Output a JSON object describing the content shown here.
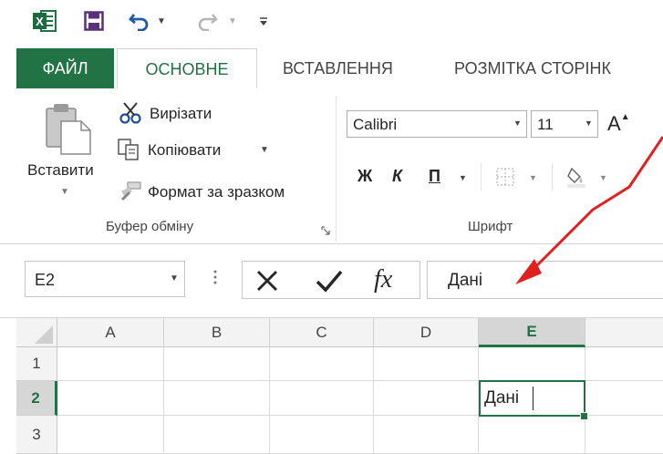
{
  "tabs": {
    "file": "ФАЙЛ",
    "home": "ОСНОВНЕ",
    "insert": "ВСТАВЛЕННЯ",
    "page_layout": "РОЗМІТКА СТОРІНК"
  },
  "clipboard": {
    "paste": "Вставити",
    "cut": "Вирізати",
    "copy": "Копіювати",
    "format_painter": "Формат за зразком",
    "group_label": "Буфер обміну"
  },
  "font": {
    "name": "Calibri",
    "size": "11",
    "bold": "Ж",
    "italic": "К",
    "underline": "П",
    "grow_font": "A",
    "group_label": "Шрифт"
  },
  "formula_bar": {
    "name_box": "E2",
    "fx": "fx",
    "content": "Дані"
  },
  "grid": {
    "columns": [
      "A",
      "B",
      "C",
      "D",
      "E"
    ],
    "rows": [
      "1",
      "2",
      "3"
    ],
    "active_cell_value": "Дані"
  },
  "colors": {
    "excel_green": "#217346",
    "arrow_red": "#e02020"
  }
}
